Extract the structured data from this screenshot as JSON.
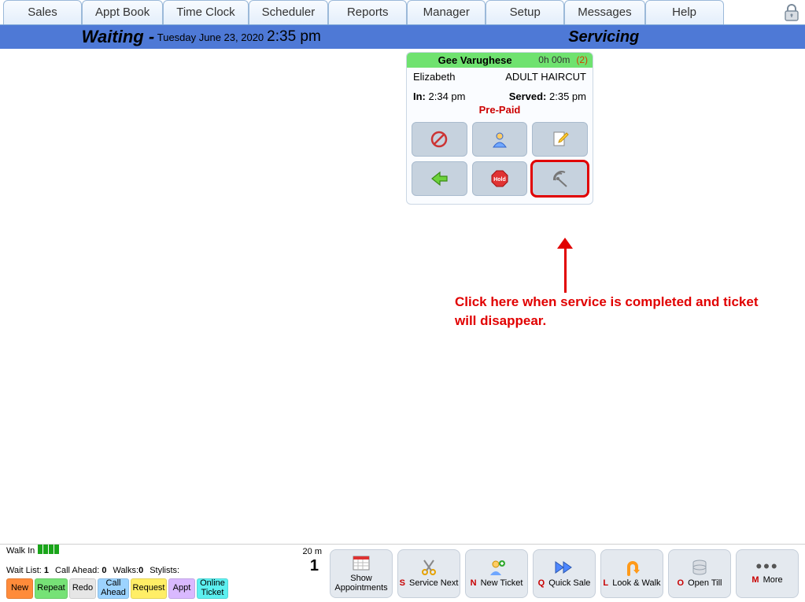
{
  "menubar": {
    "tabs": [
      "Sales",
      "Appt Book",
      "Time Clock",
      "Scheduler",
      "Reports",
      "Manager",
      "Setup",
      "Messages",
      "Help"
    ]
  },
  "statusbar": {
    "left_label": "Waiting -",
    "date": "Tuesday June 23, 2020",
    "time": "2:35 pm",
    "right_label": "Servicing"
  },
  "ticket": {
    "stylist": "Gee Varughese",
    "duration": "0h 00m",
    "count": "(2)",
    "customer": "Elizabeth",
    "service": "ADULT HAIRCUT",
    "in_label": "In:",
    "in_time": "2:34 pm",
    "served_label": "Served:",
    "served_time": "2:35 pm",
    "prepaid": "Pre-Paid",
    "buttons": {
      "noentry": "no-entry-icon",
      "client": "client-icon",
      "edit": "edit-note-icon",
      "back": "back-arrow-icon",
      "hold": "hold-icon",
      "complete": "satellite-complete-icon"
    }
  },
  "annotation": {
    "text": "Click here when service is completed and ticket will disappear."
  },
  "bottom_left": {
    "walkin_label": "Walk In",
    "right_small": "20 m",
    "stats": {
      "wait_list_label": "Wait List:",
      "wait_list": "1",
      "call_ahead_label": "Call Ahead:",
      "call_ahead": "0",
      "walks_label": "Walks:",
      "walks": "0",
      "stylists_label": "Stylists:",
      "big_number": "1"
    },
    "mini_buttons": [
      {
        "label": "New",
        "color": "c-orange"
      },
      {
        "label": "Repeat",
        "color": "c-green"
      },
      {
        "label": "Redo",
        "color": "c-grey"
      },
      {
        "label": "Call\nAhead",
        "color": "c-blue"
      },
      {
        "label": "Request",
        "color": "c-yellow"
      },
      {
        "label": "Appt",
        "color": "c-purple"
      },
      {
        "label": "Online\nTicket",
        "color": "c-cyan"
      }
    ]
  },
  "bottom_right": {
    "buttons": [
      {
        "icon": "calendar-icon",
        "hotkey": "",
        "label": "Show Appointments"
      },
      {
        "icon": "scissors-icon",
        "hotkey": "S",
        "label": "Service Next"
      },
      {
        "icon": "person-plus-icon",
        "hotkey": "N",
        "label": "New Ticket"
      },
      {
        "icon": "fast-forward-icon",
        "hotkey": "Q",
        "label": "Quick Sale"
      },
      {
        "icon": "u-turn-icon",
        "hotkey": "L",
        "label": "Look & Walk"
      },
      {
        "icon": "database-icon",
        "hotkey": "O",
        "label": "Open Till"
      },
      {
        "icon": "dots-icon",
        "hotkey": "M",
        "label": "More"
      }
    ]
  }
}
